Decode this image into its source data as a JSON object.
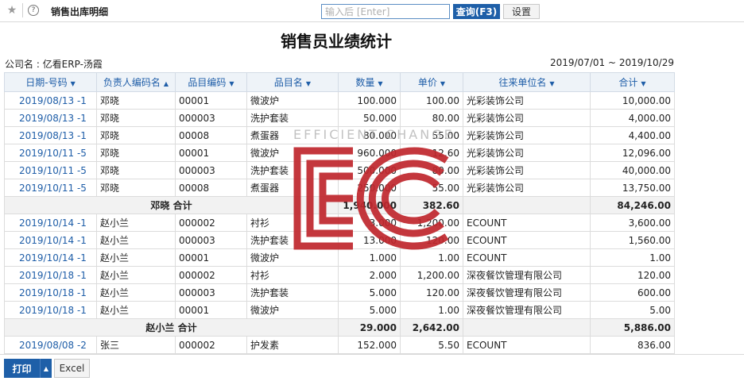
{
  "topbar": {
    "menu_title": "销售出库明细",
    "search_placeholder": "输入后 [Enter]",
    "query_label": "查询(F3)",
    "settings_label": "设置"
  },
  "report": {
    "title": "销售员业绩统计",
    "company": "公司名 : 亿看ERP-汤霞",
    "date_range": "2019/07/01 ~ 2019/10/29"
  },
  "columns": [
    {
      "label": "日期-号码",
      "sort": "▼"
    },
    {
      "label": "负责人编码名",
      "sort": "▲"
    },
    {
      "label": "品目编码",
      "sort": "▼"
    },
    {
      "label": "品目名",
      "sort": "▼"
    },
    {
      "label": "数量",
      "sort": "▼"
    },
    {
      "label": "单价",
      "sort": "▼"
    },
    {
      "label": "往来单位名",
      "sort": "▼"
    },
    {
      "label": "合计",
      "sort": "▼"
    }
  ],
  "rows": [
    {
      "date": "2019/08/13 -1",
      "person": "邓晓",
      "code": "00001",
      "item": "微波炉",
      "qty": "100.000",
      "price": "100.00",
      "partner": "光彩装饰公司",
      "total": "10,000.00"
    },
    {
      "date": "2019/08/13 -1",
      "person": "邓晓",
      "code": "000003",
      "item": "洗护套装",
      "qty": "50.000",
      "price": "80.00",
      "partner": "光彩装饰公司",
      "total": "4,000.00"
    },
    {
      "date": "2019/08/13 -1",
      "person": "邓晓",
      "code": "00008",
      "item": "煮蛋器",
      "qty": "80.000",
      "price": "55.00",
      "partner": "光彩装饰公司",
      "total": "4,400.00"
    },
    {
      "date": "2019/10/11 -5",
      "person": "邓晓",
      "code": "00001",
      "item": "微波炉",
      "qty": "960.000",
      "price": "12.60",
      "partner": "光彩装饰公司",
      "total": "12,096.00"
    },
    {
      "date": "2019/10/11 -5",
      "person": "邓晓",
      "code": "000003",
      "item": "洗护套装",
      "qty": "500.000",
      "price": "80.00",
      "partner": "光彩装饰公司",
      "total": "40,000.00"
    },
    {
      "date": "2019/10/11 -5",
      "person": "邓晓",
      "code": "00008",
      "item": "煮蛋器",
      "qty": "250.000",
      "price": "55.00",
      "partner": "光彩装饰公司",
      "total": "13,750.00"
    },
    {
      "subtotal": true,
      "label": "邓晓 合计",
      "qty": "1,940.000",
      "price": "382.60",
      "total": "84,246.00"
    },
    {
      "date": "2019/10/14 -1",
      "person": "赵小兰",
      "code": "000002",
      "item": "衬衫",
      "qty": "3.000",
      "price": "1,200.00",
      "partner": "ECOUNT",
      "total": "3,600.00"
    },
    {
      "date": "2019/10/14 -1",
      "person": "赵小兰",
      "code": "000003",
      "item": "洗护套装",
      "qty": "13.000",
      "price": "120.00",
      "partner": "ECOUNT",
      "total": "1,560.00"
    },
    {
      "date": "2019/10/14 -1",
      "person": "赵小兰",
      "code": "00001",
      "item": "微波炉",
      "qty": "1.000",
      "price": "1.00",
      "partner": "ECOUNT",
      "total": "1.00"
    },
    {
      "date": "2019/10/18 -1",
      "person": "赵小兰",
      "code": "000002",
      "item": "衬衫",
      "qty": "2.000",
      "price": "1,200.00",
      "partner": "深夜餐饮管理有限公司",
      "total": "120.00"
    },
    {
      "date": "2019/10/18 -1",
      "person": "赵小兰",
      "code": "000003",
      "item": "洗护套装",
      "qty": "5.000",
      "price": "120.00",
      "partner": "深夜餐饮管理有限公司",
      "total": "600.00"
    },
    {
      "date": "2019/10/18 -1",
      "person": "赵小兰",
      "code": "00001",
      "item": "微波炉",
      "qty": "5.000",
      "price": "1.00",
      "partner": "深夜餐饮管理有限公司",
      "total": "5.00"
    },
    {
      "subtotal": true,
      "label": "赵小兰 合计",
      "qty": "29.000",
      "price": "2,642.00",
      "total": "5,886.00"
    },
    {
      "date": "2019/08/08 -2",
      "person": "张三",
      "code": "000002",
      "item": "护发素",
      "qty": "152.000",
      "price": "5.50",
      "partner": "ECOUNT",
      "total": "836.00"
    }
  ],
  "bottom": {
    "print_label": "打印",
    "excel_label": "Excel"
  },
  "watermark": {
    "text": "EFFICIENT CHANGE",
    "logo": "EC",
    "color": "#c0272d"
  },
  "colors": {
    "primary": "#1e5fa8",
    "link": "#1f5ea8",
    "header_bg": "#eef3f8",
    "subtotal_bg": "#f2f2f2"
  }
}
